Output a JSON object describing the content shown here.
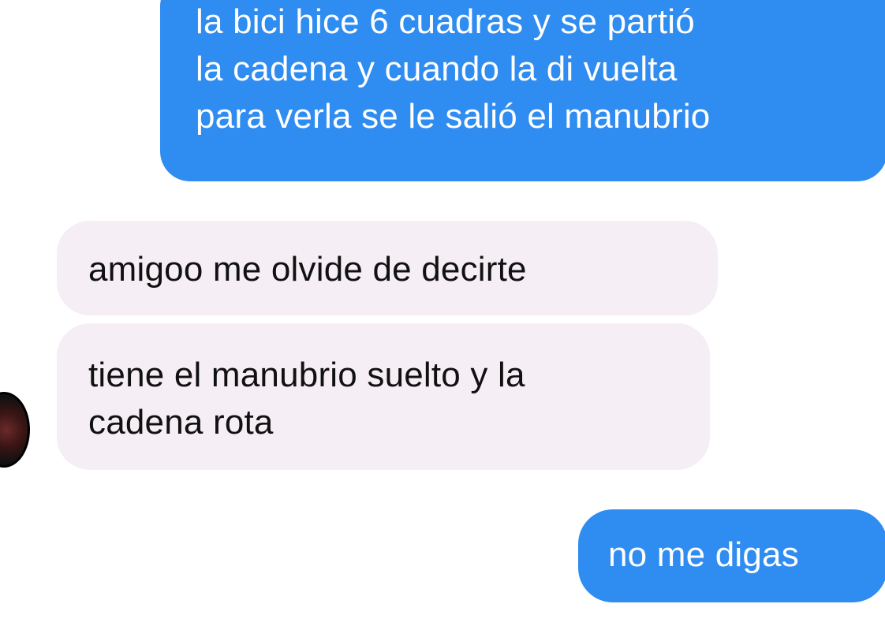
{
  "conversation": {
    "messages": [
      {
        "direction": "outgoing",
        "text": "la bici hice 6 cuadras y se partió\nla cadena y cuando la di vuelta\npara verla se le salió el manubrio"
      },
      {
        "direction": "incoming",
        "text": "amigoo me olvide de decirte"
      },
      {
        "direction": "incoming",
        "text": "tiene el manubrio suelto y la\ncadena rota"
      },
      {
        "direction": "outgoing",
        "text": "no me digas"
      }
    ]
  },
  "colors": {
    "outgoing_bubble": "#2f8cf0",
    "incoming_bubble": "#f5eef4",
    "background": "#ffffff"
  }
}
